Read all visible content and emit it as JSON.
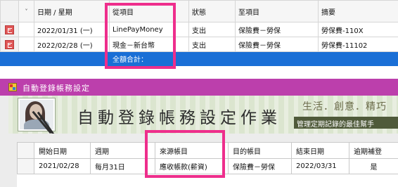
{
  "top_grid": {
    "columns": [
      "",
      "˅",
      "日期 / 星期",
      "從項目",
      "狀態",
      "至項目",
      "摘要"
    ],
    "rows": [
      {
        "date": "2022/01/31 (一)",
        "from": "LinePayMoney",
        "status": "支出",
        "to": "保險費－勞保",
        "memo": "勞保費-110X"
      },
      {
        "date": "2022/02/28 (一)",
        "from": "現金－新台幣",
        "status": "支出",
        "to": "保險費－勞保",
        "memo": "勞保費-11102"
      }
    ],
    "total_label": "全額合計："
  },
  "dialog": {
    "title": "自動登錄帳務設定",
    "banner_title": "自動登錄帳務設定作業",
    "slogan": "生活．創意．精巧",
    "tagline": "管理定期記錄的最佳幫手",
    "columns": [
      "",
      "開始日期",
      "週期",
      "來源帳目",
      "目的帳目",
      "結束日期",
      "逾期補登"
    ],
    "rows": [
      {
        "start": "2021/02/28",
        "cycle": "每月31日",
        "source": "應收帳款(薪資)",
        "target": "保險費－勞保",
        "end": "2022/03/31",
        "backfill": "是"
      }
    ]
  },
  "colors": {
    "titlebar": "#bc3fac",
    "highlight": "#ee2e8c",
    "selection": "#1a6fd6"
  },
  "icons": {
    "row_action": "delete-icon",
    "window": "app-icon"
  }
}
